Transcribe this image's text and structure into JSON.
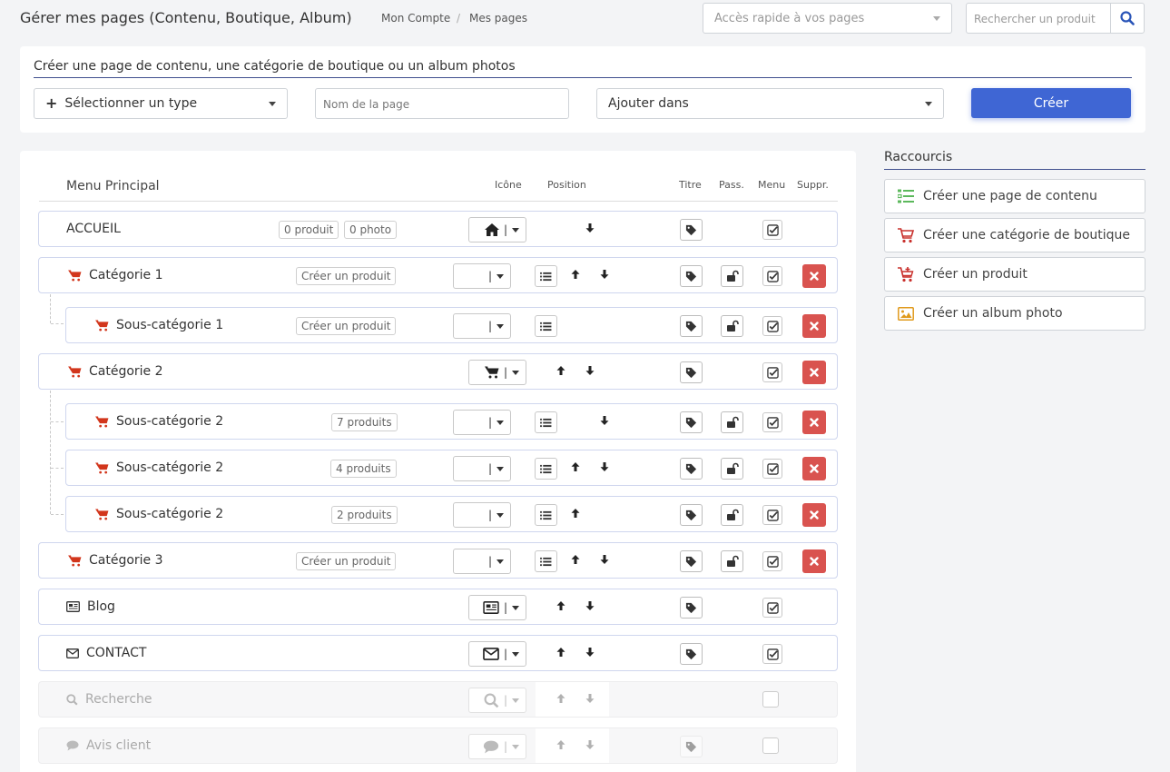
{
  "header": {
    "title": "Gérer mes pages (Contenu, Boutique, Album)",
    "breadcrumb": [
      "Mon Compte",
      "Mes pages"
    ],
    "breadcrumb_sep": "/",
    "quick_access_placeholder": "Accès rapide à vos pages",
    "search_placeholder": "Rechercher un produit"
  },
  "create": {
    "heading": "Créer une page de contenu, une catégorie de boutique ou un album photos",
    "type_select": "Sélectionner un type",
    "name_placeholder": "Nom de la page",
    "add_in": "Ajouter dans",
    "submit": "Créer"
  },
  "table": {
    "title": "Menu Principal",
    "columns": {
      "icon": "Icône",
      "position": "Position",
      "title": "Titre",
      "pass": "Pass.",
      "menu": "Menu",
      "delete": "Suppr."
    }
  },
  "rows": [
    {
      "label": "ACCUEIL",
      "badges": [
        "0 produit",
        "0 photo"
      ],
      "icon": "home-icon",
      "menu": true,
      "enabled": true
    },
    {
      "label": "Catégorie 1",
      "badges": [
        "Créer un produit"
      ],
      "icon": "cart-icon",
      "menu": true,
      "enabled": true
    },
    {
      "label": "Sous-catégorie 1",
      "badges": [
        "Créer un produit"
      ],
      "icon": "cart-icon",
      "menu": true,
      "enabled": true
    },
    {
      "label": "Catégorie 2",
      "badges": [],
      "icon": "cart-icon",
      "menu": true,
      "enabled": true
    },
    {
      "label": "Sous-catégorie 2",
      "badges": [
        "7 produits"
      ],
      "icon": "cart-icon",
      "menu": true,
      "enabled": true
    },
    {
      "label": "Sous-catégorie 2",
      "badges": [
        "4 produits"
      ],
      "icon": "cart-icon",
      "menu": true,
      "enabled": true
    },
    {
      "label": "Sous-catégorie 2",
      "badges": [
        "2 produits"
      ],
      "icon": "cart-icon",
      "menu": true,
      "enabled": true
    },
    {
      "label": "Catégorie 3",
      "badges": [
        "Créer un produit"
      ],
      "icon": "cart-icon",
      "menu": true,
      "enabled": true
    },
    {
      "label": "Blog",
      "badges": [],
      "icon": "newspaper-icon",
      "menu": true,
      "enabled": true
    },
    {
      "label": "CONTACT",
      "badges": [],
      "icon": "envelope-icon",
      "menu": true,
      "enabled": true
    },
    {
      "label": "Recherche",
      "badges": [],
      "icon": "search-icon",
      "menu": false,
      "enabled": false
    },
    {
      "label": "Avis client",
      "badges": [],
      "icon": "comment-icon",
      "menu": false,
      "enabled": false
    }
  ],
  "shortcuts": {
    "heading": "Raccourcis",
    "items": [
      {
        "label": "Créer une page de contenu",
        "icon": "list-icon",
        "color": "#5cb85c"
      },
      {
        "label": "Créer une catégorie de boutique",
        "icon": "cart-icon",
        "color": "#c9302c"
      },
      {
        "label": "Créer un produit",
        "icon": "cart-plus-icon",
        "color": "#c9302c"
      },
      {
        "label": "Créer un album photo",
        "icon": "image-icon",
        "color": "#e09a1c"
      }
    ]
  },
  "colors": {
    "accent": "#3f66d4",
    "danger": "#d9534f",
    "cart": "#d2361c"
  }
}
